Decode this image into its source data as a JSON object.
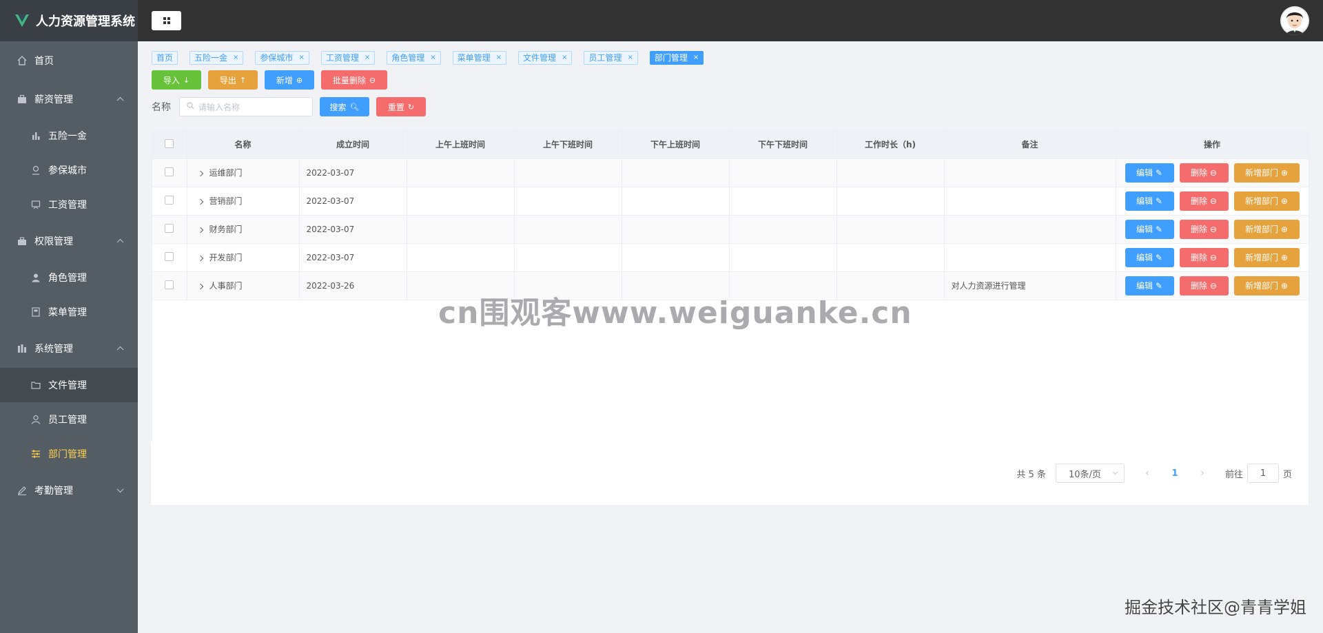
{
  "app": {
    "title": "人力资源管理系统"
  },
  "sidebar": {
    "home": "首页",
    "salary_group": "薪资管理",
    "salary_items": [
      "五险一金",
      "参保城市",
      "工资管理"
    ],
    "perm_group": "权限管理",
    "perm_items": [
      "角色管理",
      "菜单管理"
    ],
    "system_group": "系统管理",
    "system_items": [
      "文件管理",
      "员工管理",
      "部门管理"
    ],
    "attendance_group": "考勤管理",
    "active_color": "#ffd04b"
  },
  "tags": [
    {
      "label": "首页",
      "closable": false
    },
    {
      "label": "五险一金",
      "closable": true
    },
    {
      "label": "参保城市",
      "closable": true
    },
    {
      "label": "工资管理",
      "closable": true
    },
    {
      "label": "角色管理",
      "closable": true
    },
    {
      "label": "菜单管理",
      "closable": true
    },
    {
      "label": "文件管理",
      "closable": true
    },
    {
      "label": "员工管理",
      "closable": true
    },
    {
      "label": "部门管理",
      "closable": true,
      "active": true
    }
  ],
  "toolbar": {
    "import": "导入",
    "export": "导出",
    "add": "新增",
    "batch_delete": "批量删除"
  },
  "search": {
    "label": "名称",
    "placeholder": "请输入名称",
    "search_btn": "搜索",
    "reset_btn": "重置"
  },
  "table": {
    "headers": [
      "名称",
      "成立时间",
      "上午上班时间",
      "上午下班时间",
      "下午上班时间",
      "下午下班时间",
      "工作时长（h)",
      "备注",
      "操作"
    ],
    "rows": [
      {
        "name": "运维部门",
        "date": "2022-03-07",
        "note": ""
      },
      {
        "name": "营销部门",
        "date": "2022-03-07",
        "note": ""
      },
      {
        "name": "财务部门",
        "date": "2022-03-07",
        "note": ""
      },
      {
        "name": "开发部门",
        "date": "2022-03-07",
        "note": ""
      },
      {
        "name": "人事部门",
        "date": "2022-03-26",
        "note": "对人力资源进行管理"
      }
    ],
    "op_edit": "编辑",
    "op_delete": "删除",
    "op_add_dept": "新增部门"
  },
  "pager": {
    "total": "共 5 条",
    "page_size": "10条/页",
    "current": "1",
    "goto_label": "前往",
    "goto_value": "1",
    "page_unit": "页"
  },
  "watermark": "cn围观客www.weiguanke.cn",
  "credit": "掘金技术社区@青青学姐"
}
